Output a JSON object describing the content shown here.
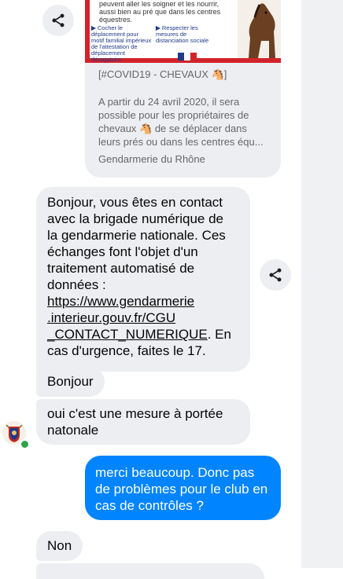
{
  "conversation": {
    "link_card": {
      "image": {
        "top_text": "peuvent aller les soigner et les nourrir, aussi bien au pré que dans les centres équestres.",
        "col1": "Cocher le déplacement pour motif familial impérieux de l'attestation de déplacement dérogatoire",
        "col2": "Respecter les mesures de distanciation sociale"
      },
      "tag": "[#COVID19 - CHEVAUX 🐴]",
      "description": "A partir du 24 avril 2020, il sera possible pour les propriétaires de chevaux 🐴 de se déplacer dans leurs prés ou dans les centres équ...",
      "source": "Gendarmerie du Rhône"
    },
    "messages": [
      {
        "id": "bot-intro",
        "lines": [
          "Bonjour, vous êtes en contact",
          "avec la brigade numérique de",
          "la gendarmerie nationale. Ces",
          "échanges font l'objet d'un",
          "traitement automatisé de",
          "données :"
        ],
        "link_lines": [
          "https://www.gendarmerie",
          ".interieur.gouv.fr/CGU",
          "_CONTACT_NUMERIQUE"
        ],
        "after_link": ". En",
        "last_line": "cas d'urgence, faites le 17."
      },
      {
        "id": "bonjour",
        "text": "Bonjour"
      },
      {
        "id": "mesure",
        "lines": [
          "oui c'est une mesure à portée",
          "natonale"
        ]
      },
      {
        "id": "merci",
        "lines": [
          "merci beaucoup. Donc pas",
          "de problèmes pour le club en",
          "cas de contrôles ?"
        ]
      },
      {
        "id": "non",
        "text": "Non"
      }
    ]
  },
  "icons": {
    "share": "share-icon",
    "horse_emoji": "🐴"
  },
  "colors": {
    "incoming_bubble": "#eceef1",
    "outgoing_bubble": "#0084ff",
    "online": "#31a24c",
    "poster_red": "#d2232a"
  }
}
